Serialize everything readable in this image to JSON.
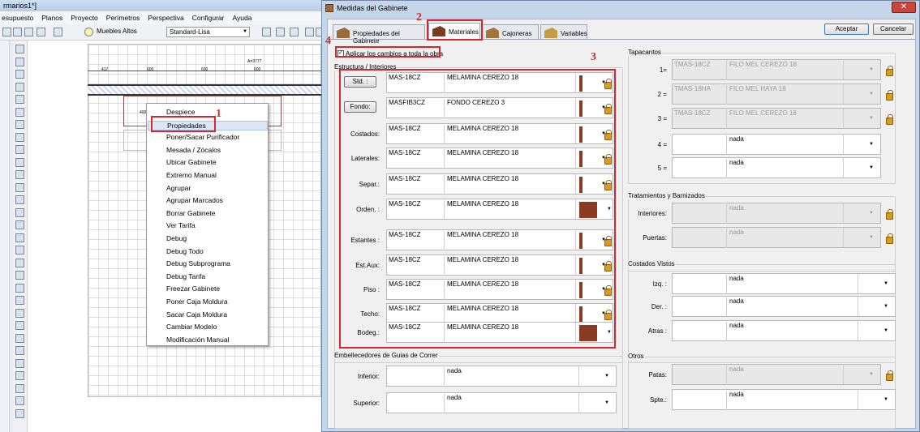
{
  "bg": {
    "title": "rmarios1*]",
    "menu": [
      "esupuesto",
      "Planos",
      "Proyecto",
      "Perímetros",
      "Perspectiva",
      "Configurar",
      "Ayuda"
    ],
    "combo1": "Muebles Altos",
    "combo2": "Standard-Lisa",
    "dims": {
      "total": "A=3777",
      "d1": "417",
      "d2": "600",
      "d3": "600",
      "d4": "600"
    },
    "small_label": "400"
  },
  "context_menu": [
    "Despiece",
    "Propiedades",
    "Poner/Sacar Purificador",
    "Mesada / Zócalos",
    "Ubicar Gabinete",
    "Extremo Manual",
    "Agrupar",
    "Agrupar Marcados",
    "Borrar Gabinete",
    "Ver Tarifa",
    "Debug",
    "Debug Todo",
    "Debug Subprograma",
    "Debug Tarifa",
    "Freezar Gabinete",
    "Poner Caja Moldura",
    "Sacar Caja Moldura",
    "Cambiar Modelo",
    "Modificación Manual"
  ],
  "annotations": {
    "n1": "1",
    "n2": "2",
    "n3": "3",
    "n4": "4"
  },
  "dialog": {
    "title": "Medidas del Gabinete",
    "tabs": [
      "Propiedades del Gabinete",
      "Materiales",
      "Cajoneras",
      "Variables"
    ],
    "accept": "Aceptar",
    "cancel": "Cancelar",
    "apply_label": "Aplicar los cambios a toda la obra",
    "estructura": {
      "title": "Estructura / Interiores",
      "rows": [
        {
          "label": "Std. :",
          "button": true,
          "code": "MAS-18CZ",
          "name": "MELAMINA CEREZO 18",
          "big": false,
          "lock": true
        },
        {
          "label": "Fondo:",
          "button": true,
          "code": "MASFIB3CZ",
          "name": "FONDO CEREZO 3",
          "big": false,
          "lock": true
        },
        {
          "label": "Costados:",
          "code": "MAS-18CZ",
          "name": "MELAMINA CEREZO 18",
          "big": false,
          "lock": true
        },
        {
          "label": "Laterales:",
          "code": "MAS-18CZ",
          "name": "MELAMINA CEREZO 18",
          "big": false,
          "lock": true
        },
        {
          "label": "Separ.:",
          "code": "MAS-18CZ",
          "name": "MELAMINA CEREZO 18",
          "big": false,
          "lock": true
        },
        {
          "label": "Orden. :",
          "code": "MAS-18CZ",
          "name": "MELAMINA CEREZO 18",
          "big": true,
          "lock": false
        },
        {
          "label": "Estantes :",
          "code": "MAS-18CZ",
          "name": "MELAMINA CEREZO 18",
          "big": false,
          "lock": true
        },
        {
          "label": "Est.Aux:",
          "code": "MAS-18CZ",
          "name": "MELAMINA CEREZO 18",
          "big": false,
          "lock": true
        },
        {
          "label": "Piso :",
          "code": "MAS-18CZ",
          "name": "MELAMINA CEREZO 18",
          "big": false,
          "lock": true
        },
        {
          "label": "Techo:",
          "code": "MAS-18CZ",
          "name": "MELAMINA CEREZO 18",
          "big": false,
          "lock": true
        },
        {
          "label": "Bodeg.:",
          "code": "MAS-18CZ",
          "name": "MELAMINA CEREZO 18",
          "big": true,
          "lock": false
        }
      ]
    },
    "embellecedores": {
      "title": "Embellecedores de Guias de Correr",
      "rows": [
        {
          "label": "Inferior:",
          "code": "",
          "name": "nada"
        },
        {
          "label": "Superior:",
          "code": "",
          "name": "nada"
        }
      ]
    },
    "tapacantos": {
      "title": "Tapacantos",
      "rows": [
        {
          "label": "1=",
          "code": "TMAS-18CZ",
          "name": "FILO MEL CEREZO 18",
          "disabled": true,
          "lock": true
        },
        {
          "label": "2 =",
          "code": "TMAS-18HA",
          "name": "FILO MEL HAYA 18",
          "disabled": true,
          "lock": true
        },
        {
          "label": "3 =",
          "code": "TMAS-18CZ",
          "name": "FILO MEL CEREZO 18",
          "disabled": true,
          "lock": true
        },
        {
          "label": "4 =",
          "code": "",
          "name": "nada",
          "disabled": false,
          "lock": false
        },
        {
          "label": "5 =",
          "code": "",
          "name": "nada",
          "disabled": false,
          "lock": false
        }
      ]
    },
    "tratamientos": {
      "title": "Tratamientos y Barnizados",
      "rows": [
        {
          "label": "Interiores:",
          "code": "",
          "name": "nada",
          "disabled": true,
          "lock": true
        },
        {
          "label": "Puertas:",
          "code": "",
          "name": "nada",
          "disabled": true,
          "lock": true
        }
      ]
    },
    "costados_vistos": {
      "title": "Costados Vistos",
      "rows": [
        {
          "label": "Izq. :",
          "code": "",
          "name": "nada"
        },
        {
          "label": "Der. :",
          "code": "",
          "name": "nada"
        },
        {
          "label": "Atras :",
          "code": "",
          "name": "nada"
        }
      ]
    },
    "otros": {
      "title": "Otros",
      "rows": [
        {
          "label": "Patas:",
          "code": "",
          "name": "nada",
          "disabled": true,
          "lock": true
        },
        {
          "label": "Spte.:",
          "code": "",
          "name": "nada",
          "disabled": false,
          "lock": false
        }
      ]
    }
  },
  "colors": {
    "accent_red": "#d7262e",
    "wood": "#8a3b22"
  }
}
